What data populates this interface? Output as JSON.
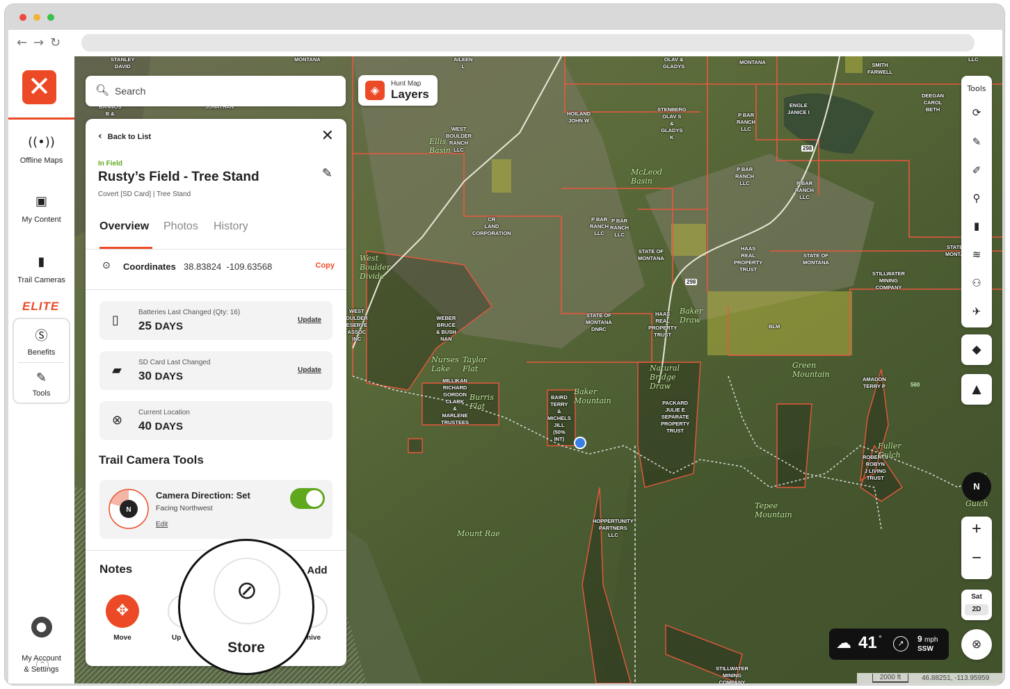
{
  "sidebar": {
    "items": [
      {
        "label": "Offline Maps",
        "icon": "offline-maps-icon"
      },
      {
        "label": "My Content",
        "icon": "my-content-icon"
      },
      {
        "label": "Trail Cameras",
        "icon": "trail-camera-icon"
      }
    ],
    "elite": "ELITE",
    "benefits": "Benefits",
    "tools": "Tools",
    "account": "My Account\n& Settings"
  },
  "search": {
    "placeholder": "Search"
  },
  "layers": {
    "small": "Hunt Map",
    "big": "Layers"
  },
  "panel": {
    "back": "Back to List",
    "status": "In Field",
    "title": "Rusty’s Field - Tree Stand",
    "subtitle": "Covert [SD Card] | Tree Stand",
    "tabs": [
      "Overview",
      "Photos",
      "History"
    ],
    "coords_label": "Coordinates",
    "coords_value": "38.83824  -109.63568",
    "copy": "Copy",
    "cards": [
      {
        "label": "Batteries Last Changed (Qty: 16)",
        "value": "25",
        "unit": "DAYS",
        "action": "Update"
      },
      {
        "label": "SD Card Last Changed",
        "value": "30",
        "unit": "DAYS",
        "action": "Update"
      },
      {
        "label": "Current Location",
        "value": "40",
        "unit": "DAYS",
        "action": ""
      }
    ],
    "tools_heading": "Trail Camera Tools",
    "direction_title": "Camera Direction: Set",
    "direction_sub": "Facing Northwest",
    "direction_edit": "Edit",
    "direction_on": true,
    "notes": "Notes",
    "add": "Add",
    "move": "Move",
    "upload_partial": "Up",
    "archive_partial": "hive",
    "store": "Store"
  },
  "toolbar": {
    "title": "Tools"
  },
  "map_controls": {
    "north": "N",
    "sat": "Sat",
    "mode": "2D"
  },
  "weather": {
    "temp": "41",
    "deg": "°",
    "wind": "9",
    "wind_unit": "mph",
    "dir": "SSW"
  },
  "scale": {
    "distance": "2000 ft",
    "coords": "46.88251, -113.95959"
  },
  "map_labels": [
    {
      "t": "STANLEY\nDAVID"
    },
    {
      "t": "MONTANA"
    },
    {
      "t": "AILEEN\nL"
    },
    {
      "t": "OLAV &\nGLADYS"
    },
    {
      "t": "MONTANA"
    },
    {
      "t": "SMITH\nFARWELL"
    },
    {
      "t": "LLC"
    },
    {
      "t": "DEEGAN\nCAROL\nBETH"
    },
    {
      "t": "BANNOS\nB &"
    },
    {
      "t": "JONATHAN"
    },
    {
      "t": "HOILAND\nJOHN W"
    },
    {
      "t": "STENBERG\nOLAV S\n&\nGLADYS\nK"
    },
    {
      "t": "P BAR\nRANCH\nLLC"
    },
    {
      "t": "ENGLE\nJANICE I"
    },
    {
      "t": "WEST\nBOULDER\nRANCH\nLLC"
    },
    {
      "t": "P BAR\nRANCH\nLLC"
    },
    {
      "t": "P BAR\nRANCH\nLLC"
    },
    {
      "t": "P BAR\nRANCH\nLLC"
    },
    {
      "t": "CR\nLAND\nCORPORATION"
    },
    {
      "t": "P BAR\nRANCH\nLLC"
    },
    {
      "t": "STATE OF\nMONTANA"
    },
    {
      "t": "HAAS\nREAL\nPROPERTY\nTRUST"
    },
    {
      "t": "STATE OF\nMONTANA"
    },
    {
      "t": "STATE\nMONTA"
    },
    {
      "t": "STILLWATER\nMINING\nCOMPANY"
    },
    {
      "t": "WEST\nOULDER\nESERVE\nASSOC\nINC"
    },
    {
      "t": "WEBER\nBRUCE\n& BUSH\nNAN"
    },
    {
      "t": "STATE OF\nMONTANA\nDNRC"
    },
    {
      "t": "HAAS\nREAL\nPROPERTY\nTRUST"
    },
    {
      "t": "BLM"
    },
    {
      "t": "AMADON\nTERRY P"
    },
    {
      "t": "MILLIKAN\nRICHARD\nGORDON\nCLARK\n&\nMARLENE\nTRUSTEES"
    },
    {
      "t": "BAIRD\nTERRY\n&\nMICHELS\nJILL\n(50%\nINT)"
    },
    {
      "t": "PACKARD\nJULIE E\nSEPARATE\nPROPERTY\nTRUST"
    },
    {
      "t": "ROBERTS\nROBYN\nJ LIVING\nTRUST"
    },
    {
      "t": "HOPPERTUNITY\nPARTNERS\nLLC"
    },
    {
      "t": "STILLWATER\nMINING\nCOMPANY"
    }
  ],
  "map_names": [
    {
      "t": "Ellis\nBasin"
    },
    {
      "t": "McLeod\nBasin"
    },
    {
      "t": "West\nBoulder\nDivide"
    },
    {
      "t": "Baker\nDraw"
    },
    {
      "t": "Green\nMountain"
    },
    {
      "t": "Taylor\nFlat"
    },
    {
      "t": "Nurses\nLake"
    },
    {
      "t": "Burris\nFlat"
    },
    {
      "t": "Natural\nBridge\nDraw"
    },
    {
      "t": "Baker\nMountain"
    },
    {
      "t": "Tepee\nMountain"
    },
    {
      "t": "Mount Rae"
    },
    {
      "t": "Fuller\nGulch"
    },
    {
      "t": "Gulch"
    }
  ],
  "road_labels": [
    "298",
    "298",
    "560"
  ]
}
